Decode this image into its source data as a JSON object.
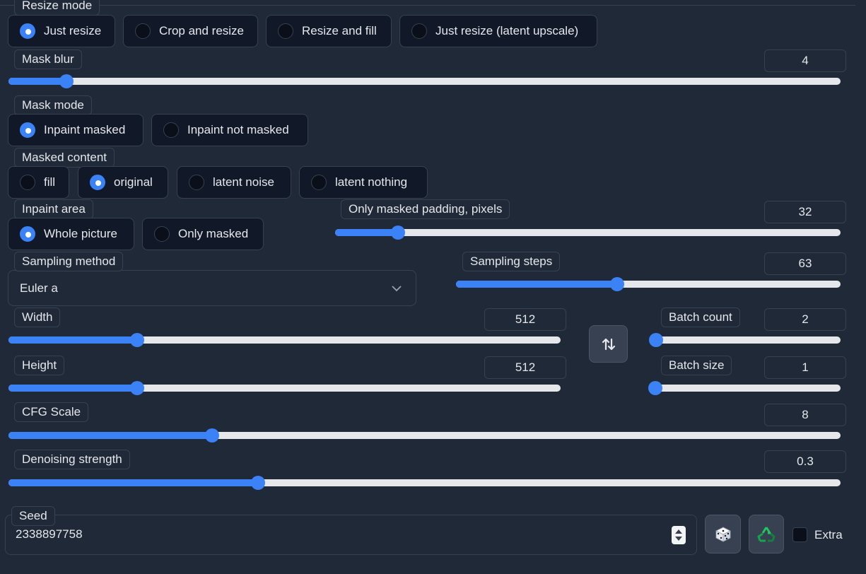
{
  "resize_mode": {
    "label": "Resize mode",
    "options": [
      "Just resize",
      "Crop and resize",
      "Resize and fill",
      "Just resize (latent upscale)"
    ],
    "selected": "Just resize"
  },
  "mask_blur": {
    "label": "Mask blur",
    "value": "4",
    "fraction": 0.07
  },
  "mask_mode": {
    "label": "Mask mode",
    "options": [
      "Inpaint masked",
      "Inpaint not masked"
    ],
    "selected": "Inpaint masked"
  },
  "masked_content": {
    "label": "Masked content",
    "options": [
      "fill",
      "original",
      "latent noise",
      "latent nothing"
    ],
    "selected": "original"
  },
  "inpaint_area": {
    "label": "Inpaint area",
    "options": [
      "Whole picture",
      "Only masked"
    ],
    "selected": "Whole picture"
  },
  "only_masked_padding": {
    "label": "Only masked padding, pixels",
    "value": "32",
    "fraction": 0.125
  },
  "sampling_method": {
    "label": "Sampling method",
    "value": "Euler a"
  },
  "sampling_steps": {
    "label": "Sampling steps",
    "value": "63",
    "fraction": 0.42
  },
  "width": {
    "label": "Width",
    "value": "512",
    "fraction": 0.233
  },
  "height": {
    "label": "Height",
    "value": "512",
    "fraction": 0.233
  },
  "batch_count": {
    "label": "Batch count",
    "value": "2",
    "fraction": 0.0
  },
  "batch_size": {
    "label": "Batch size",
    "value": "1",
    "fraction": 0.0
  },
  "cfg_scale": {
    "label": "CFG Scale",
    "value": "8",
    "fraction": 0.245
  },
  "denoising_strength": {
    "label": "Denoising strength",
    "value": "0.3",
    "fraction": 0.3
  },
  "seed": {
    "label": "Seed",
    "value": "2338897758"
  },
  "extra": {
    "label": "Extra",
    "checked": false
  },
  "icons": {
    "swap": "swap-dimensions-icon",
    "dice": "dice-icon",
    "recycle": "recycle-icon",
    "chevron": "chevron-down-icon"
  },
  "colors": {
    "accent": "#3b82f6",
    "background": "#1f2937",
    "track": "#e5e7eb"
  }
}
